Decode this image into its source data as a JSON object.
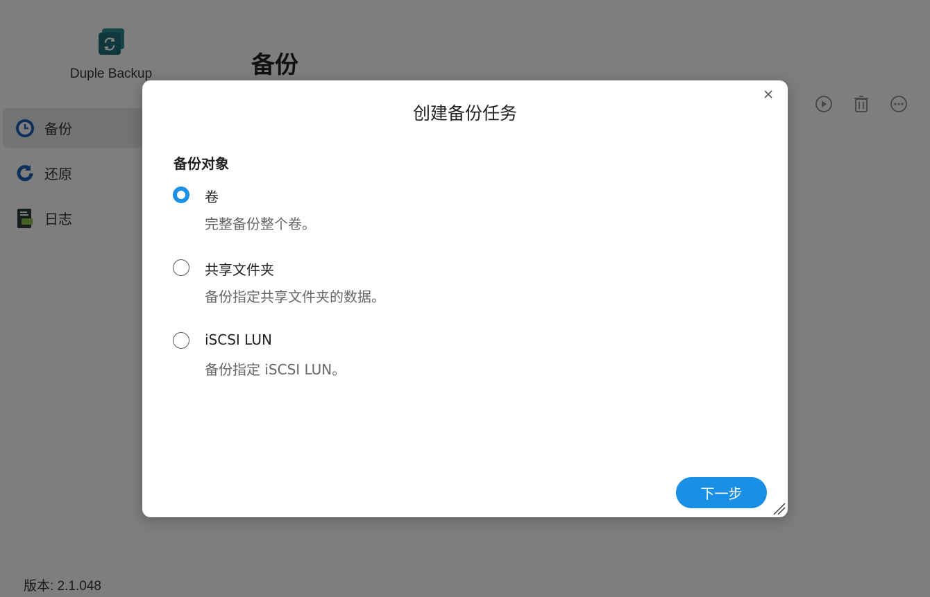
{
  "app": {
    "name": "Duple Backup",
    "page_title": "备份",
    "version": "版本: 2.1.048",
    "nav": [
      {
        "label": "备份",
        "icon": "backup-clock-icon"
      },
      {
        "label": "还原",
        "icon": "restore-icon"
      },
      {
        "label": "日志",
        "icon": "log-icon"
      }
    ],
    "toolbar_icons": [
      "play-icon",
      "delete-icon",
      "more-icon"
    ]
  },
  "modal": {
    "title": "创建备份任务",
    "section_label": "备份对象",
    "options": [
      {
        "label": "卷",
        "description": "完整备份整个卷。",
        "selected": true
      },
      {
        "label": "共享文件夹",
        "description": "备份指定共享文件夹的数据。",
        "selected": false
      },
      {
        "label": "iSCSI LUN",
        "description": "备份指定 iSCSI LUN。",
        "selected": false
      }
    ],
    "next_label": "下一步"
  },
  "colors": {
    "accent": "#1a8fe6",
    "logo": "#1f6f78",
    "overlay": "rgba(0,0,0,0.5)"
  }
}
